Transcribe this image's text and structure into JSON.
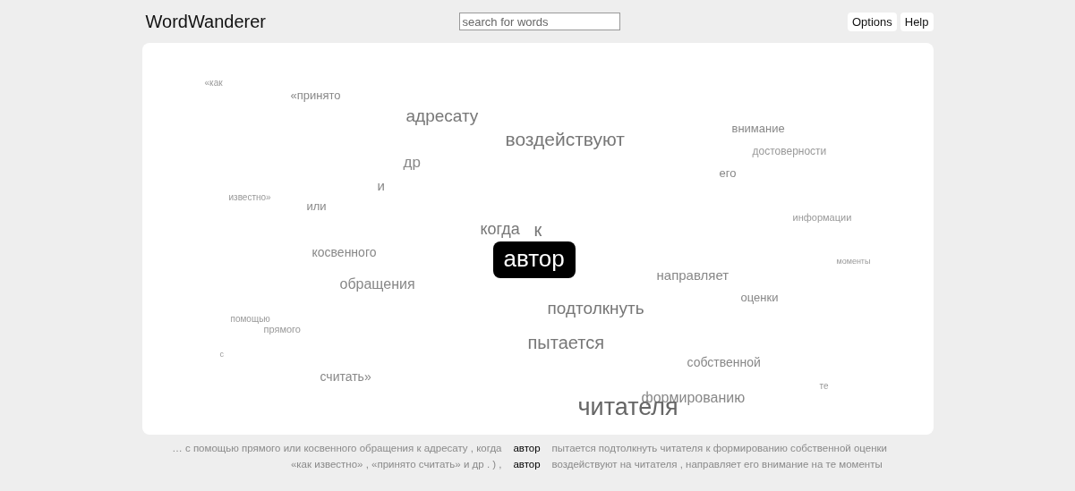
{
  "header": {
    "title": "WordWanderer",
    "search": {
      "placeholder": "search for words"
    },
    "links": [
      "Options",
      "Help"
    ]
  },
  "cloud": {
    "words": [
      {
        "text": "«как",
        "selected": false
      },
      {
        "text": "«принято",
        "selected": false
      },
      {
        "text": "адресату",
        "selected": false
      },
      {
        "text": "воздействуют",
        "selected": false
      },
      {
        "text": "внимание",
        "selected": false
      },
      {
        "text": "достоверности",
        "selected": false
      },
      {
        "text": "др",
        "selected": false
      },
      {
        "text": "и",
        "selected": false
      },
      {
        "text": "его",
        "selected": false
      },
      {
        "text": "известно»",
        "selected": false
      },
      {
        "text": "или",
        "selected": false
      },
      {
        "text": "информации",
        "selected": false
      },
      {
        "text": "когда",
        "selected": false
      },
      {
        "text": "к",
        "selected": false
      },
      {
        "text": "косвенного",
        "selected": false
      },
      {
        "text": "автор",
        "selected": true
      },
      {
        "text": "моменты",
        "selected": false
      },
      {
        "text": "направляет",
        "selected": false
      },
      {
        "text": "обращения",
        "selected": false
      },
      {
        "text": "оценки",
        "selected": false
      },
      {
        "text": "подтолкнуть",
        "selected": false
      },
      {
        "text": "помощью",
        "selected": false
      },
      {
        "text": "прямого",
        "selected": false
      },
      {
        "text": "пытается",
        "selected": false
      },
      {
        "text": "с",
        "selected": false
      },
      {
        "text": "собственной",
        "selected": false
      },
      {
        "text": "считать»",
        "selected": false
      },
      {
        "text": "те",
        "selected": false
      },
      {
        "text": "формированию",
        "selected": false
      },
      {
        "text": "читателя",
        "selected": false
      }
    ]
  },
  "concordance": [
    {
      "left": "… с помощью прямого или косвенного обращения к адресату , когда",
      "keyword": "автор",
      "right": "пытается подтолкнуть читателя к формированию собственной оценки"
    },
    {
      "left": "«как известно» , «принято считать» и др . ) ,",
      "keyword": "автор",
      "right": "воздействуют на читателя , направляет его внимание на те моменты"
    }
  ]
}
